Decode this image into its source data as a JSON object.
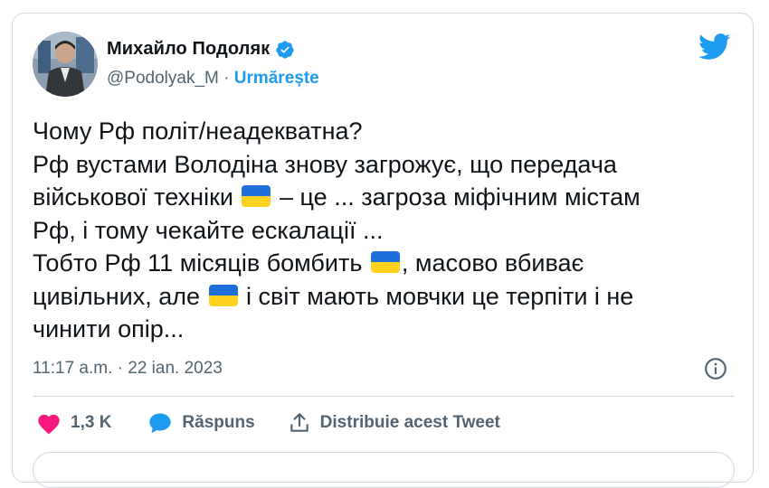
{
  "author": {
    "name": "Михайло Подоляк",
    "handle": "@Podolyak_M",
    "separator": " · ",
    "follow_label": "Urmărește"
  },
  "tweet": {
    "lines": [
      [
        "Чому Рф політ/неадекватна?"
      ],
      [
        "Рф вустами Володіна знову загрожує, що передача"
      ],
      [
        "військової техніки ",
        "– це ... загроза міфічним містам"
      ],
      [
        "Рф, і тому чекайте ескалації ..."
      ],
      [
        "Тобто Рф 11 місяців бомбить ",
        ", масово вбиває"
      ],
      [
        "цивільних, але ",
        " і світ мають мовчки це терпіти і не"
      ],
      [
        "чинити опір..."
      ]
    ],
    "timestamp": "11:17 a.m. · 22 ian. 2023"
  },
  "actions": {
    "likes_count": "1,3 K",
    "reply_label": "Răspuns",
    "share_label": "Distribuie acest Tweet"
  },
  "colors": {
    "accent": "#1d9bf0",
    "like": "#f91880",
    "text": "#0f1419",
    "muted": "#536471",
    "flag_blue": "#1e6fd9",
    "flag_yellow": "#ffd21f"
  },
  "icons": {
    "verified": "verified-badge-icon",
    "logo": "twitter-bird-icon",
    "flag": "ukraine-flag-emoji",
    "info": "info-icon",
    "like": "heart-icon",
    "reply": "speech-bubble-icon",
    "share": "share-upload-icon"
  }
}
